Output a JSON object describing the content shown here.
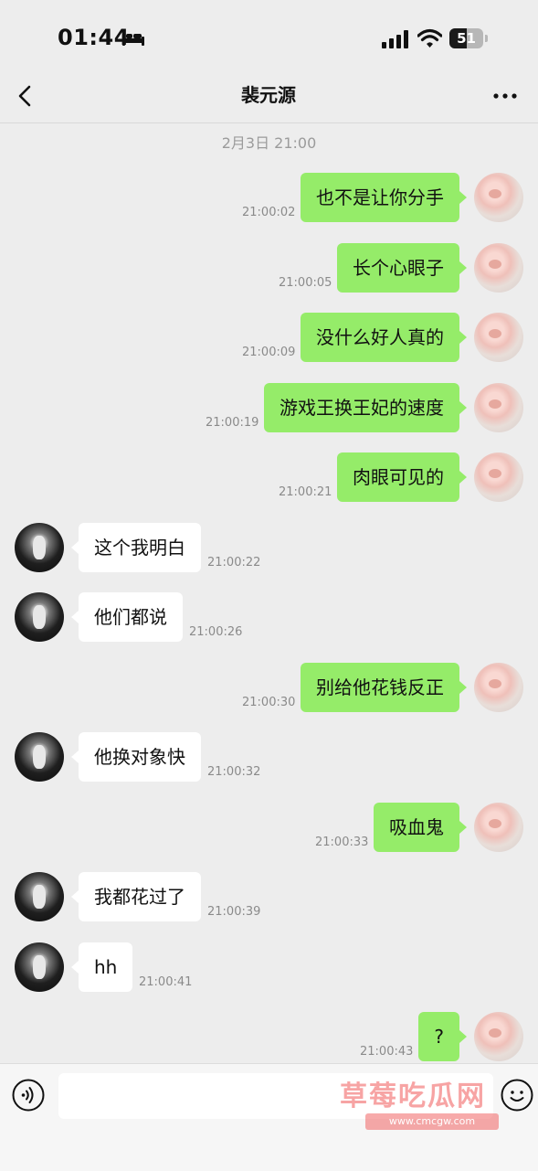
{
  "status_bar": {
    "time": "01:44",
    "battery_level": "51",
    "battery_fraction": 0.51
  },
  "header": {
    "title": "裴元源",
    "back_icon": "chevron-left-icon",
    "more_icon": "more-horizontal-icon"
  },
  "date_separator": "2月3日 21:00",
  "messages": [
    {
      "side": "out",
      "text": "也不是让你分手",
      "time": "21:00:02"
    },
    {
      "side": "out",
      "text": "长个心眼子",
      "time": "21:00:05"
    },
    {
      "side": "out",
      "text": "没什么好人真的",
      "time": "21:00:09"
    },
    {
      "side": "out",
      "text": "游戏王换王妃的速度",
      "time": "21:00:19"
    },
    {
      "side": "out",
      "text": "肉眼可见的",
      "time": "21:00:21"
    },
    {
      "side": "in",
      "text": "这个我明白",
      "time": "21:00:22"
    },
    {
      "side": "in",
      "text": "他们都说",
      "time": "21:00:26"
    },
    {
      "side": "out",
      "text": "别给他花钱反正",
      "time": "21:00:30"
    },
    {
      "side": "in",
      "text": "他换对象快",
      "time": "21:00:32"
    },
    {
      "side": "out",
      "text": "吸血鬼",
      "time": "21:00:33"
    },
    {
      "side": "in",
      "text": "我都花过了",
      "time": "21:00:39"
    },
    {
      "side": "in",
      "text": "hh",
      "time": "21:00:41"
    },
    {
      "side": "out",
      "text": "?",
      "time": "21:00:43"
    }
  ],
  "input_bar": {
    "voice_icon": "voice-icon",
    "message_value": "",
    "emoji_icon": "emoji-icon"
  },
  "watermark": {
    "title": "草莓吃瓜网",
    "url": "www.cmcgw.com"
  },
  "colors": {
    "background": "#ededed",
    "outgoing_bubble": "#95ec69",
    "incoming_bubble": "#ffffff",
    "timestamp": "#8a8a8a"
  }
}
